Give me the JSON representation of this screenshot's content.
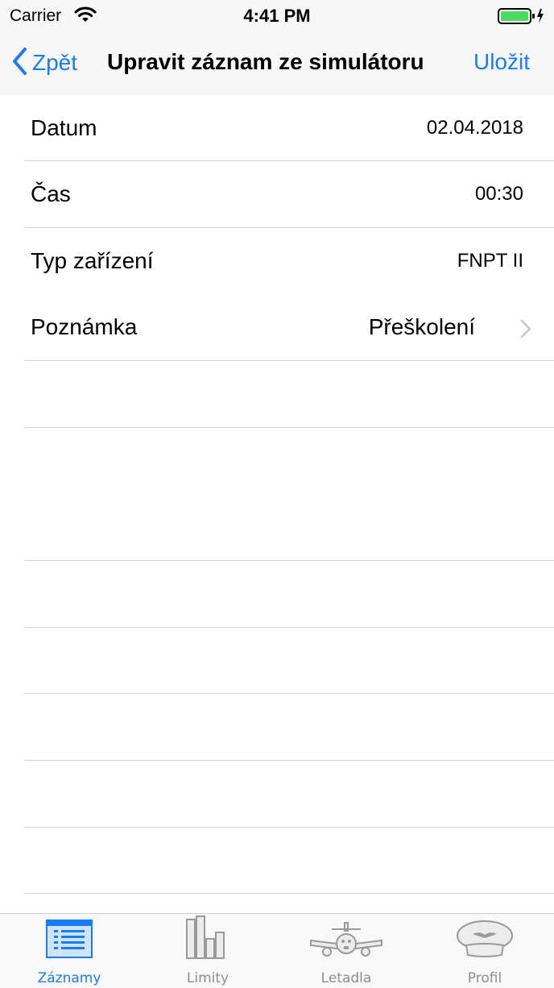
{
  "status": {
    "carrier": "Carrier",
    "time": "4:41 PM"
  },
  "nav": {
    "back_label": "Zpět",
    "title": "Upravit záznam ze simulátoru",
    "save_label": "Uložit"
  },
  "rows": [
    {
      "label": "Datum",
      "value": "02.04.2018"
    },
    {
      "label": "Čas",
      "value": "00:30"
    },
    {
      "label": "Typ zařízení",
      "value": "FNPT II"
    },
    {
      "label": "Poznámka",
      "value": "Přeškolení"
    }
  ],
  "tabs": [
    {
      "label": "Záznamy",
      "icon": "list-icon",
      "active": true
    },
    {
      "label": "Limity",
      "icon": "bar-chart-icon",
      "active": false
    },
    {
      "label": "Letadla",
      "icon": "airplane-icon",
      "active": false
    },
    {
      "label": "Profil",
      "icon": "pilot-cap-icon",
      "active": false
    }
  ],
  "colors": {
    "accent": "#1a7cf5",
    "inactive": "#8e8e93",
    "separator": "#d3d3d6"
  }
}
